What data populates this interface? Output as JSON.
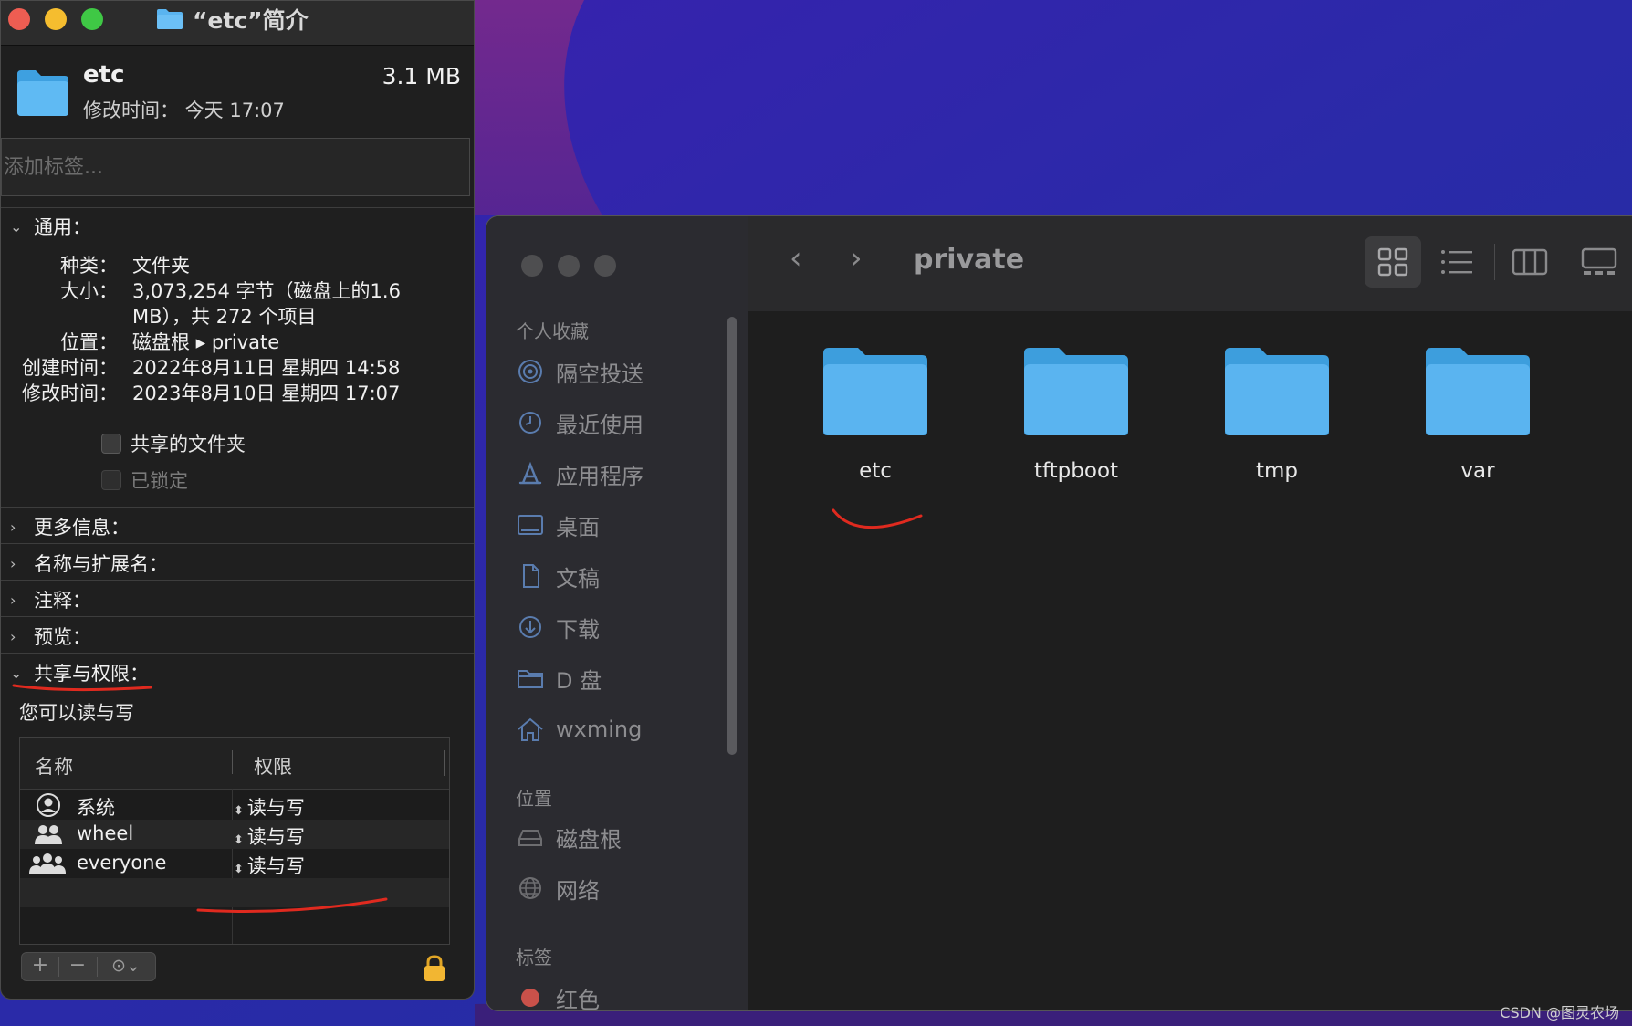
{
  "info_window": {
    "title": "“etc”简介",
    "file_name": "etc",
    "modified_line": "修改时间： 今天 17:07",
    "size": "3.1 MB",
    "tags_placeholder": "添加标签...",
    "general": {
      "heading": "通用：",
      "kind_label": "种类：",
      "kind_value": "文件夹",
      "size_label": "大小：",
      "size_value_line1": "3,073,254 字节（磁盘上的1.6",
      "size_value_line2": "MB），共 272 个项目",
      "where_label": "位置：",
      "where_value": "磁盘根 ▸ private",
      "created_label": "创建时间：",
      "created_value": "2022年8月11日 星期四 14:58",
      "modified_label": "修改时间：",
      "modified_value": "2023年8月10日 星期四 17:07",
      "shared_folder": "共享的文件夹",
      "locked": "已锁定"
    },
    "sections": {
      "more_info": "更多信息：",
      "name_ext": "名称与扩展名：",
      "comments": "注释：",
      "preview": "预览：",
      "sharing": "共享与权限："
    },
    "sharing_status": "您可以读与写",
    "permissions": {
      "col_name": "名称",
      "col_privilege": "权限",
      "rows": [
        {
          "name": "系统",
          "privilege": "读与写",
          "icon": "single-user-icon"
        },
        {
          "name": "wheel",
          "privilege": "读与写",
          "icon": "group-icon"
        },
        {
          "name": "everyone",
          "privilege": "读与写",
          "icon": "everyone-icon"
        }
      ]
    },
    "buttons": {
      "add": "+",
      "remove": "−",
      "action": "⊙⌄"
    }
  },
  "finder": {
    "path": "private",
    "sidebar": {
      "favorites_title": "个人收藏",
      "favorites": [
        {
          "label": "隔空投送",
          "icon": "airdrop-icon"
        },
        {
          "label": "最近使用",
          "icon": "clock-icon"
        },
        {
          "label": "应用程序",
          "icon": "applications-icon"
        },
        {
          "label": "桌面",
          "icon": "desktop-icon"
        },
        {
          "label": "文稿",
          "icon": "document-icon"
        },
        {
          "label": "下载",
          "icon": "download-icon"
        },
        {
          "label": "D 盘",
          "icon": "folder-icon"
        },
        {
          "label": "wxming",
          "icon": "home-icon"
        }
      ],
      "locations_title": "位置",
      "locations": [
        {
          "label": "磁盘根",
          "icon": "disk-icon"
        },
        {
          "label": "网络",
          "icon": "network-icon"
        }
      ],
      "tags_title": "标签",
      "tags": [
        {
          "label": "红色",
          "color": "#c9514a"
        }
      ]
    },
    "folders": [
      "etc",
      "tftpboot",
      "tmp",
      "var"
    ]
  },
  "watermark": "CSDN @图灵农场",
  "colors": {
    "annotation_red": "#e02a1f",
    "folder_blue": "#5ab4f0"
  }
}
